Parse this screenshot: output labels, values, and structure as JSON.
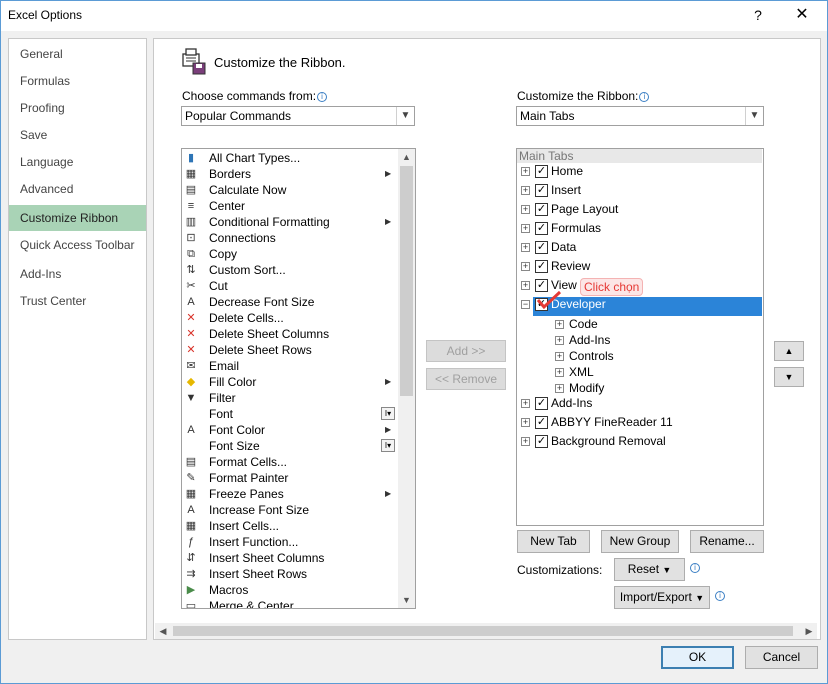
{
  "window": {
    "title": "Excel Options",
    "help": "?",
    "close": "✕"
  },
  "nav": {
    "items": [
      {
        "label": "General"
      },
      {
        "label": "Formulas"
      },
      {
        "label": "Proofing"
      },
      {
        "label": "Save"
      },
      {
        "label": "Language"
      },
      {
        "label": "Advanced"
      },
      {
        "label": "Customize Ribbon",
        "selected": true
      },
      {
        "label": "Quick Access Toolbar"
      },
      {
        "label": "Add-Ins"
      },
      {
        "label": "Trust Center"
      }
    ]
  },
  "main": {
    "heading": "Customize the Ribbon.",
    "choose_label": "Choose commands from:",
    "choose_value": "Popular Commands",
    "customize_label": "Customize the Ribbon:",
    "customize_value": "Main Tabs",
    "info": "i"
  },
  "commands": [
    {
      "label": "All Chart Types...",
      "icon": "chart-icon"
    },
    {
      "label": "Borders",
      "icon": "borders-icon",
      "submenu": true
    },
    {
      "label": "Calculate Now",
      "icon": "calculator-icon"
    },
    {
      "label": "Center",
      "icon": "center-align-icon"
    },
    {
      "label": "Conditional Formatting",
      "icon": "conditional-formatting-icon",
      "submenu": true
    },
    {
      "label": "Connections",
      "icon": "connections-icon"
    },
    {
      "label": "Copy",
      "icon": "copy-icon"
    },
    {
      "label": "Custom Sort...",
      "icon": "sort-icon"
    },
    {
      "label": "Cut",
      "icon": "scissors-icon"
    },
    {
      "label": "Decrease Font Size",
      "icon": "decrease-font-icon"
    },
    {
      "label": "Delete Cells...",
      "icon": "delete-cells-icon"
    },
    {
      "label": "Delete Sheet Columns",
      "icon": "delete-columns-icon"
    },
    {
      "label": "Delete Sheet Rows",
      "icon": "delete-rows-icon"
    },
    {
      "label": "Email",
      "icon": "email-icon"
    },
    {
      "label": "Fill Color",
      "icon": "fill-color-icon",
      "submenu": true
    },
    {
      "label": "Filter",
      "icon": "filter-icon"
    },
    {
      "label": "Font",
      "icon": "",
      "box": true
    },
    {
      "label": "Font Color",
      "icon": "font-color-icon",
      "submenu": true
    },
    {
      "label": "Font Size",
      "icon": "",
      "box": true
    },
    {
      "label": "Format Cells...",
      "icon": "format-cells-icon"
    },
    {
      "label": "Format Painter",
      "icon": "format-painter-icon"
    },
    {
      "label": "Freeze Panes",
      "icon": "freeze-panes-icon",
      "submenu": true
    },
    {
      "label": "Increase Font Size",
      "icon": "increase-font-icon"
    },
    {
      "label": "Insert Cells...",
      "icon": "insert-cells-icon"
    },
    {
      "label": "Insert Function...",
      "icon": "function-icon"
    },
    {
      "label": "Insert Sheet Columns",
      "icon": "insert-columns-icon"
    },
    {
      "label": "Insert Sheet Rows",
      "icon": "insert-rows-icon"
    },
    {
      "label": "Macros",
      "icon": "macros-icon"
    },
    {
      "label": "Merge & Center",
      "icon": "merge-center-icon"
    }
  ],
  "buttons": {
    "add": "Add >>",
    "remove": "<< Remove",
    "new_tab": "New Tab",
    "new_group": "New Group",
    "rename": "Rename...",
    "customizations_label": "Customizations:",
    "reset": "Reset",
    "import_export": "Import/Export",
    "ok": "OK",
    "cancel": "Cancel"
  },
  "tree": {
    "header": "Main Tabs",
    "tabs": [
      {
        "label": "Home",
        "checked": true
      },
      {
        "label": "Insert",
        "checked": true
      },
      {
        "label": "Page Layout",
        "checked": true
      },
      {
        "label": "Formulas",
        "checked": true
      },
      {
        "label": "Data",
        "checked": true
      },
      {
        "label": "Review",
        "checked": true
      },
      {
        "label": "View",
        "checked": true
      },
      {
        "label": "Developer",
        "checked": true,
        "expanded": true,
        "selected": true
      },
      {
        "label": "Add-Ins",
        "checked": true
      },
      {
        "label": "ABBYY FineReader 11",
        "checked": true
      },
      {
        "label": "Background Removal",
        "checked": true
      }
    ],
    "developer_groups": [
      "Code",
      "Add-Ins",
      "Controls",
      "XML",
      "Modify"
    ]
  },
  "annotation": "Click chọn",
  "colors": {
    "selected_nav": "#a9d3b6",
    "selected_row": "#2b84d8",
    "annotation": "#e53935"
  }
}
